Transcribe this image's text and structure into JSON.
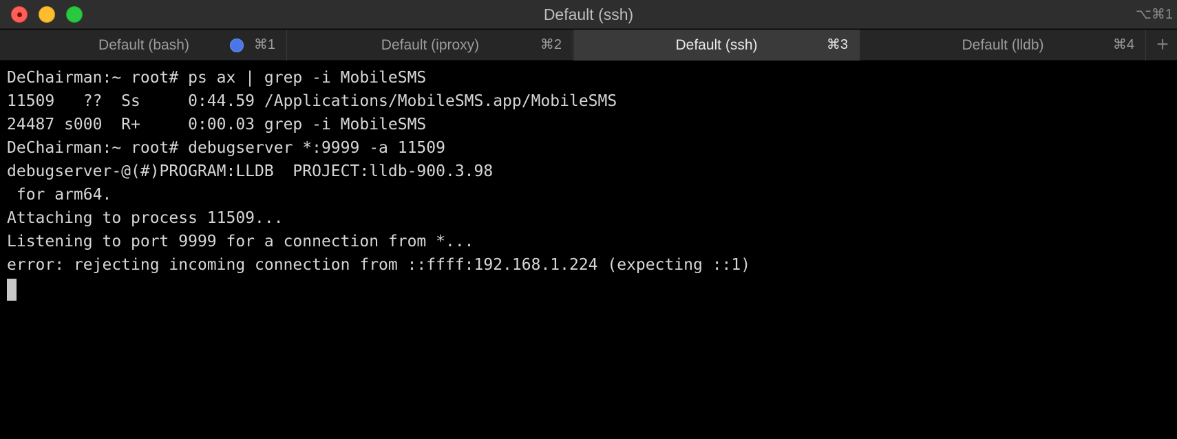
{
  "window": {
    "title": "Default (ssh)",
    "shortcut": "⌥⌘1"
  },
  "tabs": [
    {
      "label": "Default (bash)",
      "shortcut": "⌘1",
      "active": false,
      "activity_indicator": true
    },
    {
      "label": "Default (iproxy)",
      "shortcut": "⌘2",
      "active": false
    },
    {
      "label": "Default (ssh)",
      "shortcut": "⌘3",
      "active": true
    },
    {
      "label": "Default (lldb)",
      "shortcut": "⌘4",
      "active": false
    }
  ],
  "new_tab_label": "+",
  "terminal": {
    "lines": [
      "DeChairman:~ root# ps ax | grep -i MobileSMS",
      "11509   ??  Ss     0:44.59 /Applications/MobileSMS.app/MobileSMS",
      "24487 s000  R+     0:00.03 grep -i MobileSMS",
      "DeChairman:~ root# debugserver *:9999 -a 11509",
      "debugserver-@(#)PROGRAM:LLDB  PROJECT:lldb-900.3.98",
      " for arm64.",
      "Attaching to process 11509...",
      "Listening to port 9999 for a connection from *...",
      "error: rejecting incoming connection from ::ffff:192.168.1.224 (expecting ::1)"
    ]
  },
  "colors": {
    "accent_dot": "#4a77e8",
    "close": "#ff5f57",
    "minimize": "#febc2e",
    "zoom": "#28c840"
  }
}
